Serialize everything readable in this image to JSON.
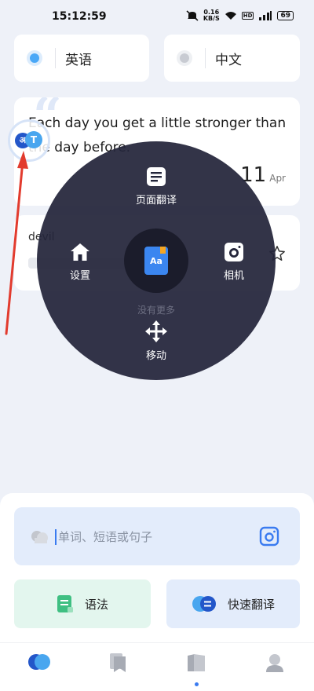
{
  "status_bar": {
    "time": "15:12:59",
    "net_speed_value": "0.16",
    "net_speed_unit": "KB/S",
    "hd": "HD",
    "battery": "69"
  },
  "languages": {
    "source": "英语",
    "target": "中文",
    "source_dot_color": "#4aa8f7",
    "target_dot_color": "#c8cbd2"
  },
  "daily_quote": {
    "marks": "“",
    "text": "Each day you get a little stronger than the day before.",
    "day": "11",
    "month": "Apr"
  },
  "word_card": {
    "word": "devil"
  },
  "radial_menu": {
    "page_translate": "页面翻译",
    "settings": "设置",
    "camera": "相机",
    "no_more": "没有更多",
    "move": "移动",
    "center_icon_text": "Aa"
  },
  "float_ball": {
    "left_glyph": "अ",
    "right_glyph": "T"
  },
  "search": {
    "placeholder": "单词、短语或句子"
  },
  "actions": {
    "grammar": "语法",
    "quick_translate": "快速翻译"
  },
  "colors": {
    "accent": "#3a7bf0",
    "annotation_arrow": "#e23b2e"
  }
}
